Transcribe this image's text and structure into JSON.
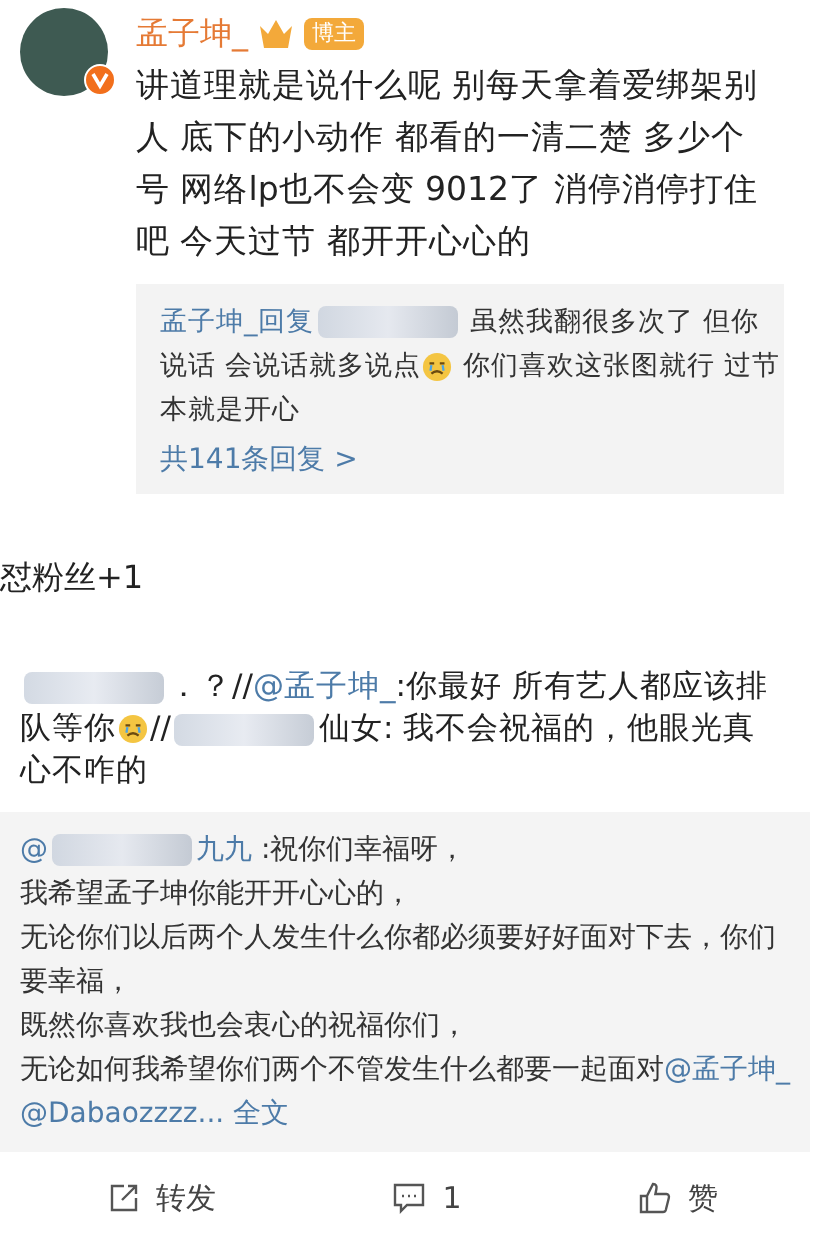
{
  "post": {
    "author": "孟子坤_",
    "crown": true,
    "badge": "博主",
    "verified": true,
    "text": "讲道理就是说什么呢 别每天拿着爱绑架别人 底下的小动作 都看的一清二楚 多少个号 网络lp也不会变 9012了 消停消停打住吧 今天过节 都开开心心的",
    "reply": [
      {
        "kind": "name",
        "text": "孟子坤_回复"
      },
      {
        "kind": "blur"
      },
      {
        "kind": "text",
        "text": " 虽然我翻很多次了 但你说话 会说话就多说点"
      },
      {
        "kind": "emoji"
      },
      {
        "kind": "text",
        "text": " 你们喜欢这张图就行 过节本就是开心"
      }
    ],
    "reply_count": "共141条回复 >"
  },
  "caption": "怼粉丝+1",
  "comment": [
    {
      "kind": "blur"
    },
    {
      "kind": "text",
      "text": "．？//"
    },
    {
      "kind": "mention",
      "text": "@孟子坤_"
    },
    {
      "kind": "text",
      "text": ":你最好 所有艺人都应该排队等你"
    },
    {
      "kind": "emoji"
    },
    {
      "kind": "text",
      "text": "//"
    },
    {
      "kind": "blur"
    },
    {
      "kind": "text",
      "text": "仙女: 我不会祝福的，他眼光真心不咋的"
    }
  ],
  "quote": [
    {
      "kind": "mention",
      "text": "@"
    },
    {
      "kind": "blur"
    },
    {
      "kind": "mention",
      "text": "九九"
    },
    {
      "kind": "text",
      "text": " :祝你们幸福呀，"
    },
    {
      "kind": "break"
    },
    {
      "kind": "text",
      "text": "我希望孟子坤你能开开心心的，"
    },
    {
      "kind": "break"
    },
    {
      "kind": "text",
      "text": "无论你们以后两个人发生什么你都必须要好好面对下去，你们要幸福，"
    },
    {
      "kind": "break"
    },
    {
      "kind": "text",
      "text": "既然你喜欢我也会衷心的祝福你们，"
    },
    {
      "kind": "break"
    },
    {
      "kind": "text",
      "text": "无论如何我希望你们两个不管发生什么都要一起面对"
    },
    {
      "kind": "mention",
      "text": "@孟子坤_"
    },
    {
      "kind": "space"
    },
    {
      "kind": "mention",
      "text": "@Dabaozzzz..."
    },
    {
      "kind": "space"
    },
    {
      "kind": "mention",
      "text": "全文"
    }
  ],
  "actions": [
    {
      "kind": "repost",
      "label": "转发"
    },
    {
      "kind": "comment",
      "label": "1"
    },
    {
      "kind": "like",
      "label": "赞"
    }
  ]
}
